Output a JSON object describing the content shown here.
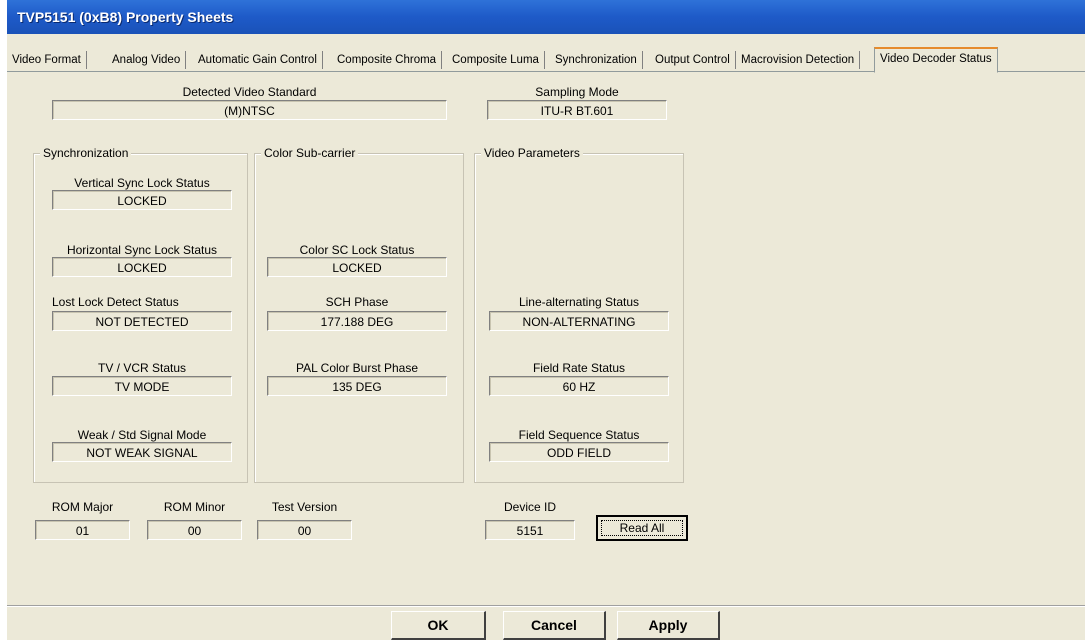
{
  "window": {
    "title": "TVP5151 (0xB8) Property Sheets"
  },
  "tabs": [
    "Video Format",
    "Analog Video",
    "Automatic Gain Control",
    "Composite Chroma",
    "Composite Luma",
    "Synchronization",
    "Output Control",
    "Macrovision Detection",
    "Video Decoder Status"
  ],
  "active_tab": "Video Decoder Status",
  "top": {
    "detected_standard": {
      "label": "Detected Video Standard",
      "value": "(M)NTSC"
    },
    "sampling_mode": {
      "label": "Sampling Mode",
      "value": "ITU-R BT.601"
    }
  },
  "groups": {
    "sync": {
      "title": "Synchronization",
      "vsync": {
        "label": "Vertical Sync Lock Status",
        "value": "LOCKED"
      },
      "hsync": {
        "label": "Horizontal Sync Lock Status",
        "value": "LOCKED"
      },
      "lost_lock": {
        "label": "Lost Lock Detect Status",
        "value": "NOT DETECTED"
      },
      "tv_vcr": {
        "label": "TV / VCR Status",
        "value": "TV MODE"
      },
      "weak_signal": {
        "label": "Weak / Std Signal Mode",
        "value": "NOT WEAK SIGNAL"
      }
    },
    "color": {
      "title": "Color Sub-carrier",
      "sc_lock": {
        "label": "Color SC Lock Status",
        "value": "LOCKED"
      },
      "sch_phase": {
        "label": "SCH Phase",
        "value": "177.188 DEG"
      },
      "pal_burst": {
        "label": "PAL Color Burst Phase",
        "value": "135 DEG"
      }
    },
    "video": {
      "title": "Video Parameters",
      "line_alt": {
        "label": "Line-alternating Status",
        "value": "NON-ALTERNATING"
      },
      "field_rate": {
        "label": "Field Rate Status",
        "value": "60 HZ"
      },
      "field_seq": {
        "label": "Field Sequence Status",
        "value": "ODD FIELD"
      }
    }
  },
  "bottom": {
    "rom_major": {
      "label": "ROM Major",
      "value": "01"
    },
    "rom_minor": {
      "label": "ROM Minor",
      "value": "00"
    },
    "test_version": {
      "label": "Test Version",
      "value": "00"
    },
    "device_id": {
      "label": "Device ID",
      "value": "5151"
    },
    "read_all": "Read All"
  },
  "buttons": {
    "ok": "OK",
    "cancel": "Cancel",
    "apply": "Apply"
  }
}
